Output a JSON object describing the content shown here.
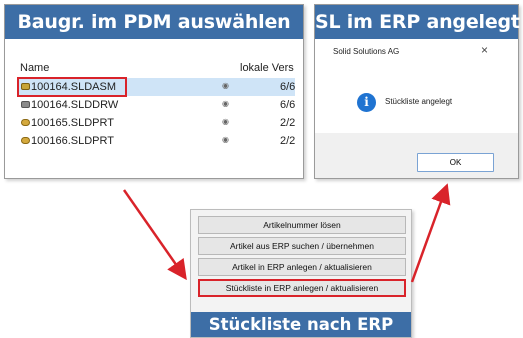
{
  "colors": {
    "banner": "#3d6ea6",
    "highlight": "#d9232a",
    "arrow": "#d9232a",
    "selection": "#cfe4f7",
    "info": "#1f73d1"
  },
  "pdm": {
    "banner": "Baugr. im PDM auswählen",
    "col_name": "Name",
    "col_version": "lokale Vers",
    "rows": [
      {
        "icon": "assembly-icon",
        "name": "100164.SLDASM",
        "version": "6/6",
        "selected": true
      },
      {
        "icon": "drawing-icon",
        "name": "100164.SLDDRW",
        "version": "6/6",
        "selected": false
      },
      {
        "icon": "part-icon",
        "name": "100165.SLDPRT",
        "version": "2/2",
        "selected": false
      },
      {
        "icon": "part-icon",
        "name": "100166.SLDPRT",
        "version": "2/2",
        "selected": false
      }
    ]
  },
  "erp": {
    "banner": "SL im ERP angelegt",
    "dialog_title": "Solid Solutions AG",
    "close": "×",
    "info_glyph": "i",
    "message": "Stückliste angelegt",
    "ok": "OK"
  },
  "menu": {
    "buttons": [
      "Artikelnummer lösen",
      "Artikel aus ERP suchen / übernehmen",
      "Artikel in ERP anlegen / aktualisieren",
      "Stückliste in ERP anlegen / aktualisieren"
    ],
    "banner": "Stückliste nach ERP"
  }
}
